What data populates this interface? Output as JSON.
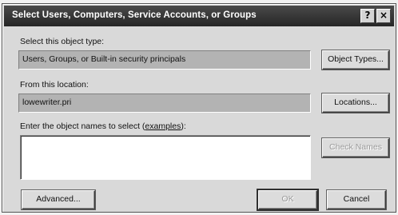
{
  "window": {
    "title": "Select Users, Computers, Service Accounts, or Groups",
    "help_glyph": "?",
    "close_glyph": "×"
  },
  "object_type": {
    "label": "Select this object type:",
    "value": "Users, Groups, or Built-in security principals",
    "button": "Object Types..."
  },
  "location": {
    "label": "From this location:",
    "value": "lowewriter.pri",
    "button": "Locations..."
  },
  "names": {
    "label_prefix": "Enter the object names to select (",
    "label_link": "examples",
    "label_suffix": "):",
    "value": "",
    "check_button": "Check Names"
  },
  "footer": {
    "advanced_button": "Advanced...",
    "ok_button": "OK",
    "cancel_button": "Cancel"
  }
}
